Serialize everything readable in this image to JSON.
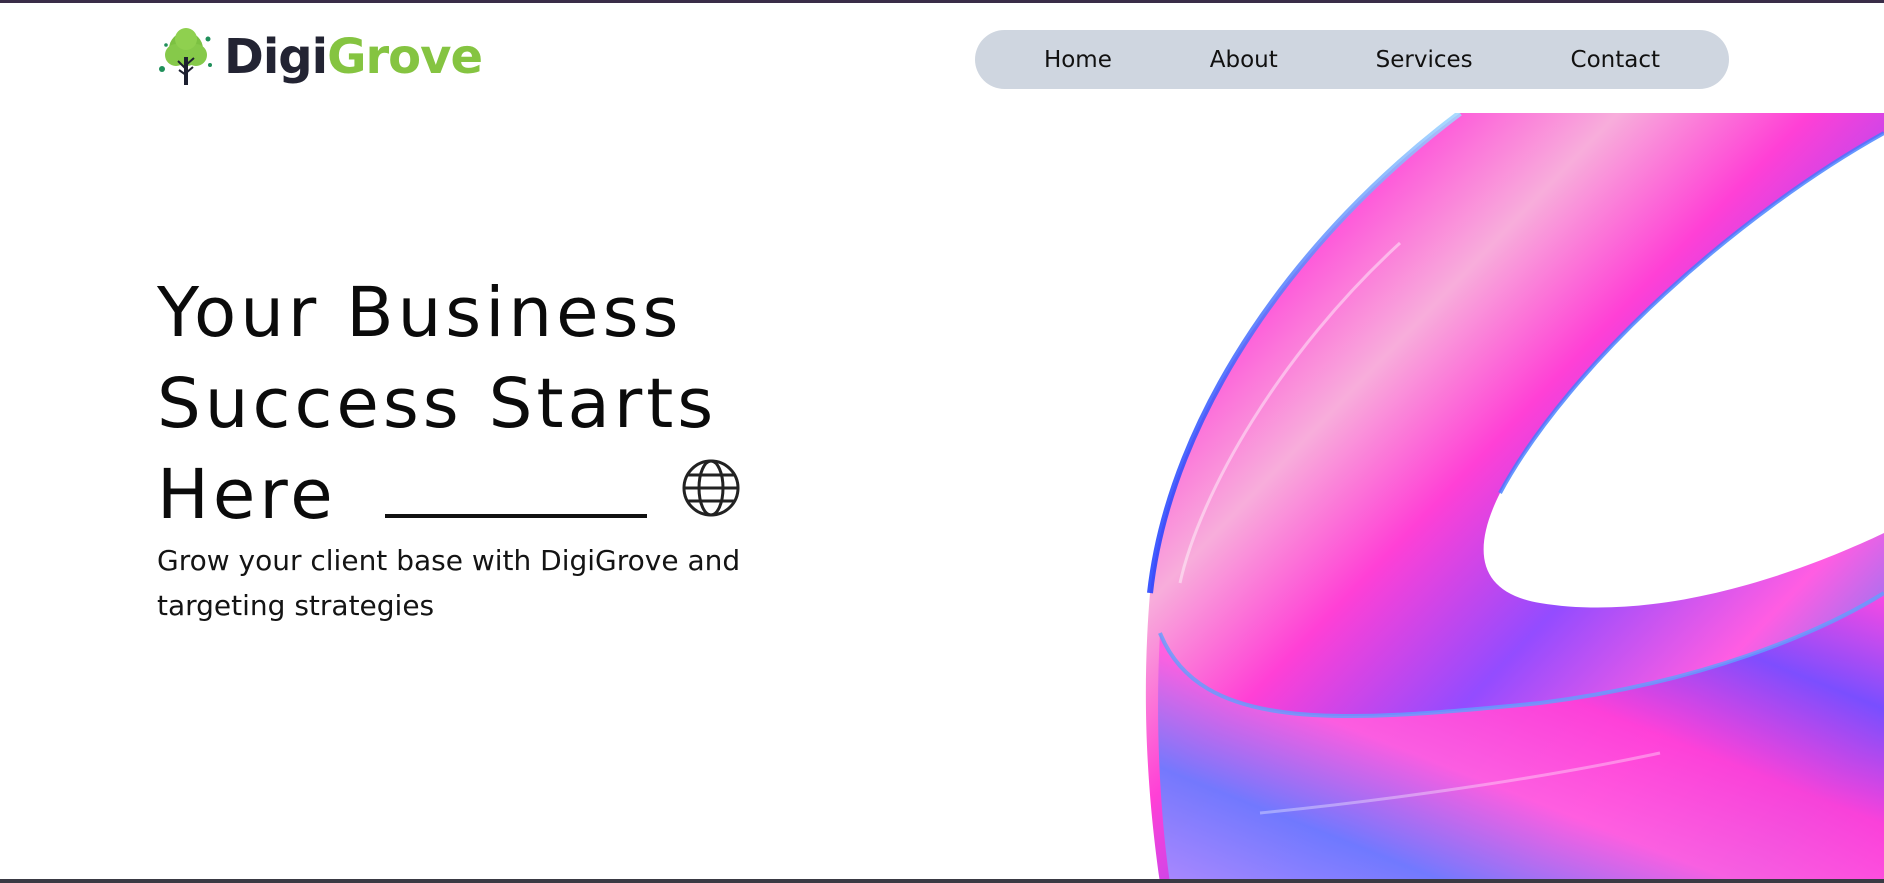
{
  "brand": {
    "name_part1": "Digi",
    "name_part2": "Grove",
    "colors": {
      "dark": "#232433",
      "green": "#85c441"
    },
    "icon": "tree-logo-icon"
  },
  "nav": {
    "items": [
      {
        "label": "Home"
      },
      {
        "label": "About"
      },
      {
        "label": "Services"
      },
      {
        "label": "Contact"
      }
    ],
    "background": "#cfd6e0"
  },
  "hero": {
    "title_lines": [
      "Your Business",
      "Success Starts",
      "Here"
    ],
    "title_icon": "globe-icon",
    "subtitle": "Grow your client base with DigiGrove and targeting strategies"
  },
  "art": {
    "icon": "iridescent-ring-graphic",
    "colors": [
      "#ff2fd2",
      "#8a3cff",
      "#3a7bff",
      "#f7a6d8"
    ]
  }
}
